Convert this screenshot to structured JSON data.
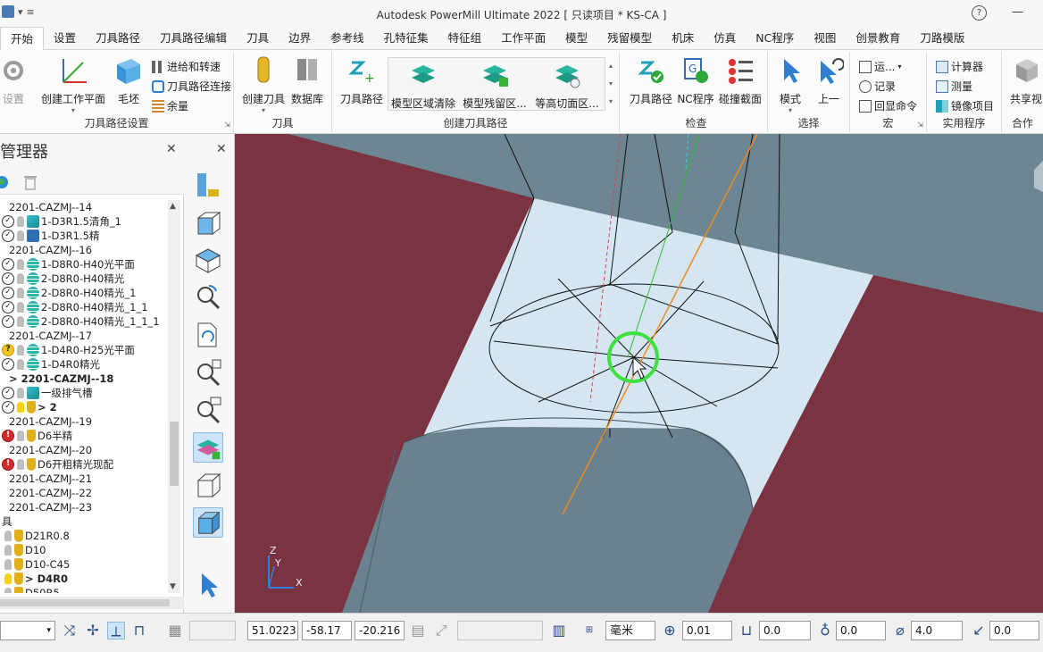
{
  "app": {
    "title": "Autodesk PowerMill Ultimate 2022    [ 只读项目 * KS-CA ]",
    "help_icon": "?"
  },
  "tabs": [
    "开始",
    "设置",
    "刀具路径",
    "刀具路径编辑",
    "刀具",
    "边界",
    "参考线",
    "孔特征集",
    "特征组",
    "工作平面",
    "模型",
    "残留模型",
    "机床",
    "仿真",
    "NC程序",
    "视图",
    "创景教育",
    "刀路模版"
  ],
  "ribbon": {
    "setup_group": {
      "settings_label": "设置",
      "create_workplane": "创建工作平面",
      "stock": "毛坯",
      "feeds_speeds": "进给和转速",
      "toolpath_connections": "刀具路径连接",
      "allowance": "余量",
      "label": "刀具路径设置"
    },
    "tool_group": {
      "create_tool": "创建刀具",
      "database": "数据库",
      "label": "刀具"
    },
    "create_toolpath_group": {
      "toolpath": "刀具路径",
      "model_area_clearance": "模型区域清除",
      "model_rest_area": "模型残留区...",
      "constant_z": "等高切面区...",
      "label": "创建刀具路径"
    },
    "verify_group": {
      "toolpath": "刀具路径",
      "nc_program": "NC程序",
      "collision": "碰撞截面",
      "label": "检查"
    },
    "select_group": {
      "mode": "模式",
      "previous": "上一",
      "label": "选择"
    },
    "macro_group": {
      "run": "运...",
      "record": "记录",
      "echo": "回显命令",
      "label": "宏"
    },
    "utilities_group": {
      "calculator": "计算器",
      "measure": "测量",
      "mirror": "镜像项目",
      "label": "实用程序"
    },
    "share_group": {
      "share_view": "共享视",
      "label": "合作"
    }
  },
  "explorer": {
    "title": "管理器",
    "rows": [
      {
        "indent": 8,
        "check": "",
        "icon": "",
        "label": "2201-CAZMJ--14",
        "bold": false
      },
      {
        "indent": 2,
        "check": "ok",
        "icon": "cyan",
        "label": "1-D3R1.5清角_1",
        "bold": false
      },
      {
        "indent": 2,
        "check": "ok",
        "icon": "blue",
        "label": "1-D3R1.5精",
        "bold": false
      },
      {
        "indent": 8,
        "check": "",
        "icon": "",
        "label": "2201-CAZMJ--16",
        "bold": false
      },
      {
        "indent": 2,
        "check": "ok",
        "icon": "stack",
        "label": "1-D8R0-H40光平面",
        "bold": false
      },
      {
        "indent": 2,
        "check": "ok",
        "icon": "stack",
        "label": "2-D8R0-H40精光",
        "bold": false
      },
      {
        "indent": 2,
        "check": "ok",
        "icon": "stack",
        "label": "2-D8R0-H40精光_1",
        "bold": false
      },
      {
        "indent": 2,
        "check": "ok",
        "icon": "stack",
        "label": "2-D8R0-H40精光_1_1",
        "bold": false
      },
      {
        "indent": 2,
        "check": "ok",
        "icon": "stack",
        "label": "2-D8R0-H40精光_1_1_1",
        "bold": false
      },
      {
        "indent": 8,
        "check": "",
        "icon": "",
        "label": "2201-CAZMJ--17",
        "bold": false
      },
      {
        "indent": 2,
        "check": "warn",
        "icon": "stack",
        "label": "1-D4R0-H25光平面",
        "bold": false
      },
      {
        "indent": 2,
        "check": "ok",
        "icon": "stack",
        "label": "1-D4R0精光",
        "bold": false
      },
      {
        "indent": 8,
        "check": "",
        "icon": "",
        "label": "> 2201-CAZMJ--18",
        "bold": true
      },
      {
        "indent": 2,
        "check": "ok",
        "icon": "cyan",
        "label": "一级排气槽",
        "bold": false
      },
      {
        "indent": 2,
        "check": "ok",
        "icon": "tool",
        "label": "> 2",
        "bold": true,
        "bulb_on": true
      },
      {
        "indent": 8,
        "check": "",
        "icon": "",
        "label": "2201-CAZMJ--19",
        "bold": false
      },
      {
        "indent": 2,
        "check": "err",
        "icon": "tool",
        "label": "D6半精",
        "bold": false
      },
      {
        "indent": 8,
        "check": "",
        "icon": "",
        "label": "2201-CAZMJ--20",
        "bold": false
      },
      {
        "indent": 2,
        "check": "err",
        "icon": "tool",
        "label": "D6开粗精光现配",
        "bold": false
      },
      {
        "indent": 8,
        "check": "",
        "icon": "",
        "label": "2201-CAZMJ--21",
        "bold": false
      },
      {
        "indent": 8,
        "check": "",
        "icon": "",
        "label": "2201-CAZMJ--22",
        "bold": false
      },
      {
        "indent": 8,
        "check": "",
        "icon": "",
        "label": "2201-CAZMJ--23",
        "bold": false
      },
      {
        "indent": 0,
        "check": "",
        "icon": "",
        "label": "具",
        "bold": false
      },
      {
        "indent": 2,
        "check": "none",
        "icon": "tool",
        "label": "D21R0.8",
        "bold": false
      },
      {
        "indent": 2,
        "check": "none",
        "icon": "tool",
        "label": "D10",
        "bold": false
      },
      {
        "indent": 2,
        "check": "none",
        "icon": "tool",
        "label": "D10-C45",
        "bold": false
      },
      {
        "indent": 2,
        "check": "none",
        "icon": "tool",
        "label": "> D4R0",
        "bold": true,
        "bulb_on": true
      },
      {
        "indent": 2,
        "check": "none",
        "icon": "tool",
        "label": "D50R5",
        "bold": false
      }
    ]
  },
  "status": {
    "x": "51.0223",
    "y": "-58.17",
    "z": "-20.216",
    "unit": "毫米",
    "tolerance": "0.01",
    "thickness": "0.0",
    "axial_thickness": "0.0",
    "diameter": "4.0",
    "angle": "0.0"
  },
  "triad": {
    "z": "Z",
    "y": "Y",
    "x": "X"
  }
}
